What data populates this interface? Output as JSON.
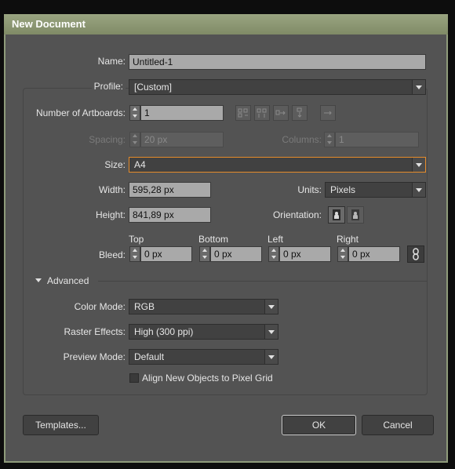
{
  "dialog": {
    "title": "New Document"
  },
  "name": {
    "label": "Name:",
    "value": "Untitled-1"
  },
  "profile": {
    "label": "Profile:",
    "value": "[Custom]"
  },
  "artboards": {
    "label": "Number of Artboards:",
    "value": "1"
  },
  "spacing": {
    "label": "Spacing:",
    "value": "20 px"
  },
  "columns": {
    "label": "Columns:",
    "value": "1"
  },
  "size": {
    "label": "Size:",
    "value": "A4"
  },
  "width": {
    "label": "Width:",
    "value": "595,28 px"
  },
  "units": {
    "label": "Units:",
    "value": "Pixels"
  },
  "height": {
    "label": "Height:",
    "value": "841,89 px"
  },
  "orientation": {
    "label": "Orientation:"
  },
  "bleed": {
    "label": "Bleed:",
    "top": {
      "label": "Top",
      "value": "0 px"
    },
    "bottom": {
      "label": "Bottom",
      "value": "0 px"
    },
    "left": {
      "label": "Left",
      "value": "0 px"
    },
    "right": {
      "label": "Right",
      "value": "0 px"
    }
  },
  "advanced": {
    "label": "Advanced"
  },
  "color_mode": {
    "label": "Color Mode:",
    "value": "RGB"
  },
  "raster_effects": {
    "label": "Raster Effects:",
    "value": "High (300 ppi)"
  },
  "preview_mode": {
    "label": "Preview Mode:",
    "value": "Default"
  },
  "align_pixel_grid": {
    "label": "Align New Objects to Pixel Grid",
    "checked": false
  },
  "buttons": {
    "templates": "Templates...",
    "ok": "OK",
    "cancel": "Cancel"
  },
  "colors": {
    "background": "#535353",
    "titlebar": "#8e9a7a",
    "accent": "#e58b2a"
  }
}
